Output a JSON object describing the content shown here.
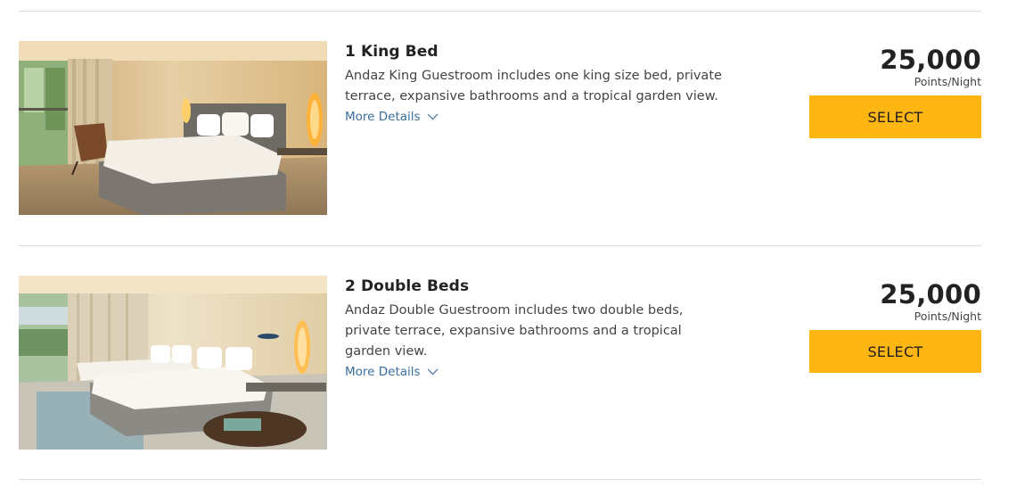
{
  "rooms": [
    {
      "title": "1 King Bed",
      "description": "Andaz King Guestroom includes one king size bed, private terrace, expansive bathrooms and a tropical garden view.",
      "more_details": "More Details",
      "points": "25,000",
      "points_label": "Points/Night",
      "select_label": "SELECT"
    },
    {
      "title": "2 Double Beds",
      "description": "Andaz Double Guestroom includes two double beds, private terrace, expansive bathrooms and a tropical garden view.",
      "more_details": "More Details",
      "points": "25,000",
      "points_label": "Points/Night",
      "select_label": "SELECT"
    }
  ],
  "colors": {
    "select_button": "#ffb612",
    "link": "#3b6e9e",
    "divider": "#dcdcdc"
  }
}
